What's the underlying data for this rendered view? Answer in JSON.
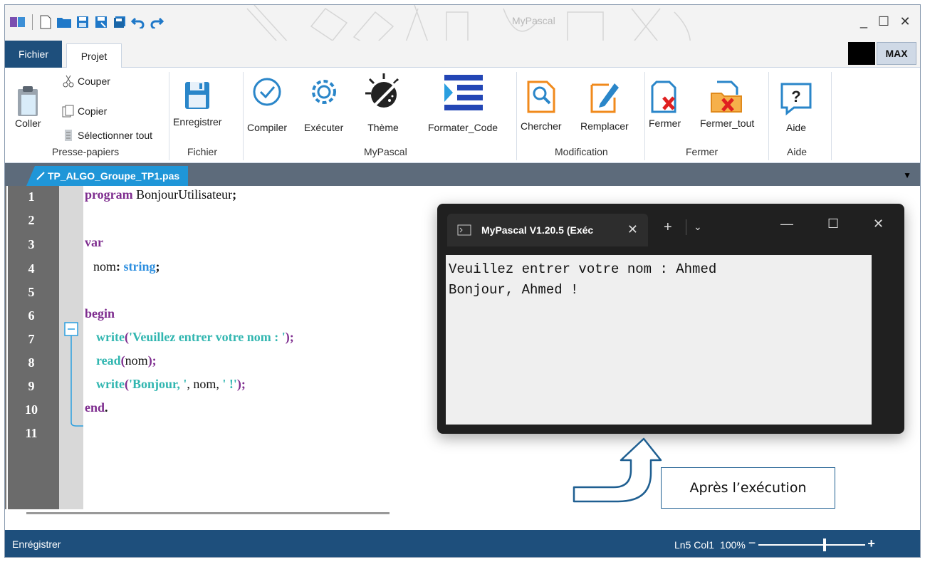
{
  "window": {
    "title": "MyPascal"
  },
  "tabs": {
    "fichier": "Fichier",
    "projet": "Projet",
    "max": "MAX"
  },
  "ribbon": {
    "clipboard": {
      "paste": "Coller",
      "cut": "Couper",
      "copy": "Copier",
      "select_all": "Sélectionner tout",
      "group": "Presse-papiers"
    },
    "file": {
      "save": "Enregistrer",
      "group": "Fichier"
    },
    "mypascal": {
      "compile": "Compiler",
      "run": "Exécuter",
      "theme": "Thème",
      "format": "Formater_Code",
      "group": "MyPascal"
    },
    "modification": {
      "search": "Chercher",
      "replace": "Remplacer",
      "group": "Modification"
    },
    "close": {
      "close": "Fermer",
      "close_all": "Fermer_tout",
      "group": "Fermer"
    },
    "help": {
      "help": "Aide",
      "group": "Aide"
    }
  },
  "document_tab": "TP_ALGO_Groupe_TP1.pas",
  "editor": {
    "line_numbers": [
      "1",
      "2",
      "3",
      "4",
      "5",
      "6",
      "7",
      "8",
      "9",
      "10",
      "11"
    ],
    "l1": {
      "kw": "program",
      "name": " BonjourUtilisateur",
      "punct": ";"
    },
    "l3": {
      "kw": "var"
    },
    "l4": {
      "name": "nom",
      "colon": ": ",
      "type": "string",
      "punct": ";"
    },
    "l6": {
      "kw": "begin"
    },
    "l7": {
      "fn": "write",
      "open": "(",
      "str": "'Veuillez entrer votre nom : '",
      "close": ");"
    },
    "l8": {
      "fn": "read",
      "open": "(",
      "arg": "nom",
      "close": ");"
    },
    "l9": {
      "fn": "write",
      "open": "(",
      "str1": "'Bonjour, '",
      "mid": ", nom, ",
      "str2": "' !'",
      "close": ");"
    },
    "l10": {
      "kw": "end",
      "punct": "."
    }
  },
  "terminal": {
    "tab_title": "MyPascal V1.20.5 (Exéc",
    "output": [
      "Veuillez entrer votre nom : Ahmed",
      "Bonjour, Ahmed !"
    ]
  },
  "callout": "Après l’exécution",
  "statusbar": {
    "left": "Enrégistrer",
    "position": "Ln5 Col1",
    "zoom": "100%",
    "zoom_fraction": 0.62
  },
  "colors": {
    "accent": "#1e4f7c",
    "tab_blue": "#1f96d8",
    "keyword": "#7e2d8f",
    "type": "#2d8fe0",
    "string": "#31b6b0"
  }
}
